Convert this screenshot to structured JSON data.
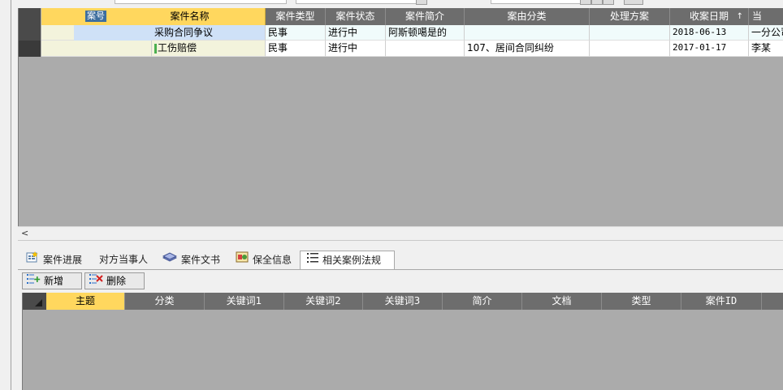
{
  "upper_grid": {
    "columns": [
      {
        "label": "案号"
      },
      {
        "label": "案件名称"
      },
      {
        "label": "案件类型"
      },
      {
        "label": "案件状态"
      },
      {
        "label": "案件简介"
      },
      {
        "label": "案由分类"
      },
      {
        "label": "处理方案"
      },
      {
        "label": "收案日期",
        "sort_icon": "↑"
      },
      {
        "label": "当"
      }
    ],
    "rows": [
      {
        "case_no": "",
        "name": "采购合同争议",
        "type": "民事",
        "status": "进行中",
        "intro": "阿斯顿噶是的",
        "cause": "",
        "plan": "",
        "date": "2018-06-13",
        "extra": "一分公司"
      },
      {
        "case_no": "",
        "name": "工伤赔偿",
        "type": "民事",
        "status": "进行中",
        "intro": "",
        "cause": "107、居间合同纠纷",
        "plan": "",
        "date": "2017-01-17",
        "extra": "李某"
      }
    ]
  },
  "scrollbar": {
    "left_arrow": "<"
  },
  "tabs": [
    {
      "label": "案件进展",
      "icon": "progress-icon"
    },
    {
      "label": "对方当事人",
      "icon": ""
    },
    {
      "label": "案件文书",
      "icon": "documents-icon"
    },
    {
      "label": "保全信息",
      "icon": "preservation-icon"
    },
    {
      "label": "相关案例法规",
      "icon": "list-icon",
      "active": true
    }
  ],
  "actions": {
    "add_label": "新增",
    "delete_label": "删除"
  },
  "lower_grid": {
    "columns": [
      "主题",
      "分类",
      "关键词1",
      "关键词2",
      "关键词3",
      "简介",
      "文档",
      "类型",
      "案件ID"
    ]
  },
  "colors": {
    "header_bg": "#6d6d6d",
    "selected_header": "#ffd75e",
    "grid_empty": "#ababab"
  }
}
